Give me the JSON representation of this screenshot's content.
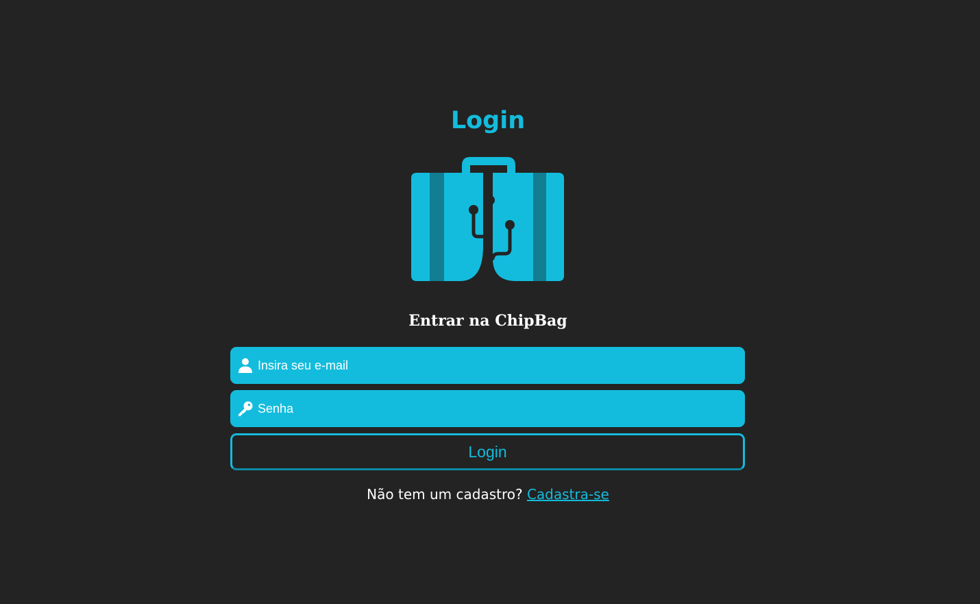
{
  "page": {
    "title": "Login",
    "subtitle": "Entrar na ChipBag"
  },
  "logo": {
    "icon": "briefcase-circuit-icon",
    "color": "#13bcdc",
    "stripe_color": "#117e92",
    "circuit_color": "#232323"
  },
  "form": {
    "email": {
      "placeholder": "Insira seu e-mail",
      "value": "",
      "icon": "user-icon"
    },
    "password": {
      "placeholder": "Senha",
      "value": "",
      "icon": "key-icon"
    },
    "login_label": "Login"
  },
  "signup": {
    "prompt": "Não tem um cadastro?",
    "link_label": "Cadastra-se"
  },
  "colors": {
    "background": "#232323",
    "accent": "#13bcdc",
    "text": "#ffffff"
  }
}
